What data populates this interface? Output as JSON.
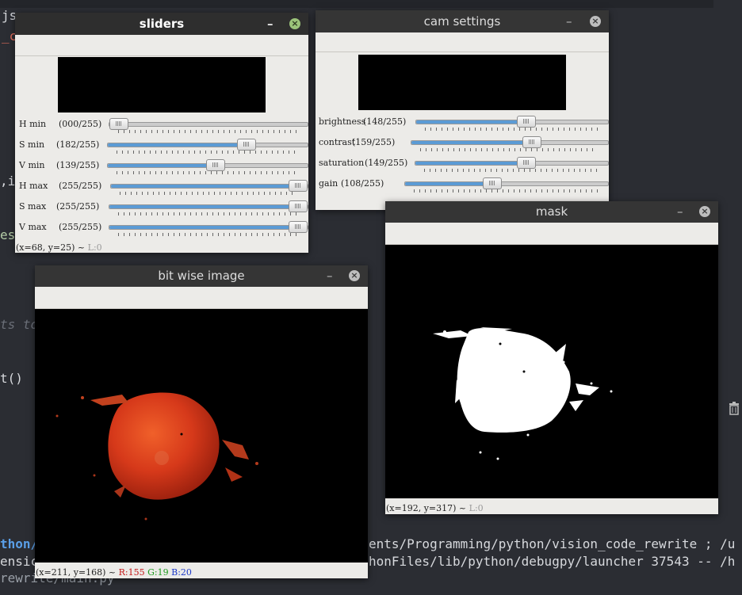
{
  "background": {
    "code_fragments": [
      "js",
      "_c",
      ",i",
      "es",
      "ts to",
      "t()",
      "thon/",
      "ensic",
      "rewrite/main.py"
    ],
    "terminal_line_1": "ents/Programming/python/vision_code_rewrite ; /u",
    "terminal_line_2": "honFiles/lib/python/debugpy/launcher 37543 -- /h",
    "trash_icon": "trash-icon"
  },
  "colors": {
    "slider_fill": "#5b9bd5",
    "titlebar": "#353535",
    "close_active": "#9bc37a",
    "window_bg": "#ecebe8"
  },
  "sliders_window": {
    "title": "sliders",
    "min_symbol": "–",
    "close_symbol": "×",
    "sliders": [
      {
        "label": "H min",
        "value_text": "(000/255)",
        "value": 0,
        "max": 255
      },
      {
        "label": "S min",
        "value_text": "(182/255)",
        "value": 182,
        "max": 255
      },
      {
        "label": "V min",
        "value_text": "(139/255)",
        "value": 139,
        "max": 255
      },
      {
        "label": "H max",
        "value_text": "(255/255)",
        "value": 255,
        "max": 255
      },
      {
        "label": "S max",
        "value_text": "(255/255)",
        "value": 255,
        "max": 255
      },
      {
        "label": "V max",
        "value_text": "(255/255)",
        "value": 255,
        "max": 255
      }
    ],
    "status": "(x=68, y=25) ~ ",
    "status_l": "L:0"
  },
  "cam_window": {
    "title": "cam settings",
    "min_symbol": "–",
    "close_symbol": "×",
    "sliders": [
      {
        "label": "brightness",
        "value_text": "(148/255)",
        "value": 148,
        "max": 255
      },
      {
        "label": "contrast",
        "value_text": "(159/255)",
        "value": 159,
        "max": 255
      },
      {
        "label": "saturation",
        "value_text": "(149/255)",
        "value": 149,
        "max": 255
      },
      {
        "label": "gain",
        "value_text": "(108/255)",
        "value": 108,
        "max": 255
      }
    ]
  },
  "mask_window": {
    "title": "mask",
    "min_symbol": "–",
    "close_symbol": "×",
    "status": "(x=192, y=317) ~ ",
    "status_l": "L:0"
  },
  "bitwise_window": {
    "title": "bit wise image",
    "min_symbol": "–",
    "close_symbol": "×",
    "status": "(x=211, y=168) ~ ",
    "status_r": "R:155",
    "status_g": "G:19",
    "status_b": "B:20"
  }
}
